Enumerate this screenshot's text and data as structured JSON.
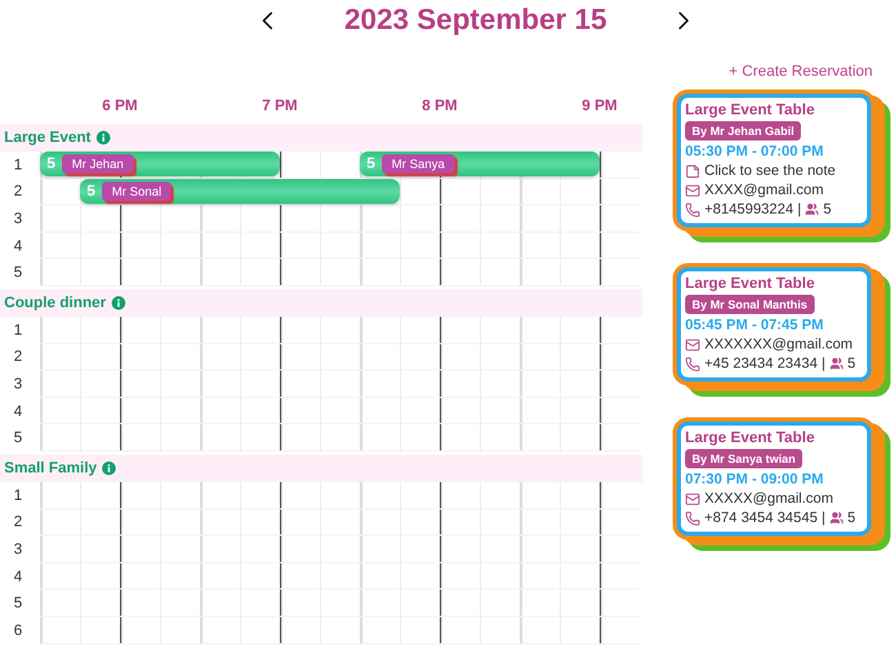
{
  "header": {
    "title": "2023 September 15"
  },
  "create_link": "+ Create Reservation",
  "timeline": {
    "hours": [
      "6 PM",
      "7 PM",
      "8 PM",
      "9 PM"
    ]
  },
  "sections": [
    {
      "name": "Large Event",
      "rows": [
        {
          "label": "1",
          "bookings": [
            {
              "guests": "5",
              "name": "Mr Jehan",
              "card": {
                "title": "Large Event Table",
                "owner": "By Mr Jehan Gabil",
                "time": "05:30 PM - 07:00 PM",
                "note": "Click to see the note",
                "email": "XXXX@gmail.com",
                "phone": "+8145993224",
                "separator": "|",
                "guests": "5"
              }
            },
            {
              "guests": "5",
              "name": "Mr Sanya",
              "card": {
                "title": "Large Event Table",
                "owner": "By Mr Sanya twian",
                "time": "07:30 PM - 09:00 PM",
                "email": "XXXXX@gmail.com",
                "phone": "+874 3454 34545",
                "separator": "|",
                "guests": "5"
              }
            }
          ]
        },
        {
          "label": "2",
          "bookings": [
            {
              "guests": "5",
              "name": "Mr Sonal",
              "card": {
                "title": "Large Event Table",
                "owner": "By Mr Sonal Manthis",
                "time": "05:45 PM - 07:45 PM",
                "email": "XXXXXXX@gmail.com",
                "phone": "+45 23434 23434",
                "separator": "|",
                "guests": "5"
              }
            }
          ]
        },
        {
          "label": "3"
        },
        {
          "label": "4"
        },
        {
          "label": "5"
        }
      ]
    },
    {
      "name": "Couple dinner",
      "rows": [
        {
          "label": "1"
        },
        {
          "label": "2"
        },
        {
          "label": "3"
        },
        {
          "label": "4"
        },
        {
          "label": "5"
        }
      ]
    },
    {
      "name": "Small Family",
      "rows": [
        {
          "label": "1"
        },
        {
          "label": "2"
        },
        {
          "label": "3"
        },
        {
          "label": "4"
        },
        {
          "label": "5"
        },
        {
          "label": "6"
        }
      ]
    }
  ]
}
